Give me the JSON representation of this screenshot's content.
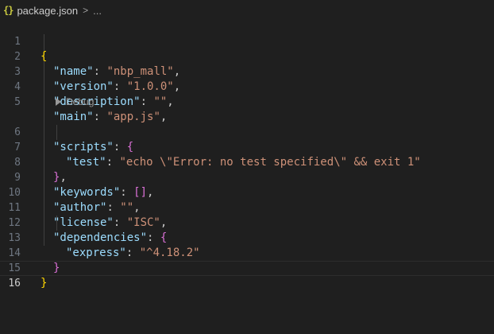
{
  "breadcrumb": {
    "icon": "json-braces-icon",
    "icon_glyph": "{}",
    "file": "package.json",
    "separator": ">",
    "more": "..."
  },
  "codelens": {
    "label": "Debug",
    "icon": "play-icon"
  },
  "current_line": 16,
  "colors": {
    "background": "#1f1f1f",
    "bracket_level1": "#ffd700",
    "bracket_level2": "#da70d6",
    "json_key": "#9cdcfe",
    "json_string": "#ce9178",
    "line_number": "#6e7681"
  },
  "lines": [
    {
      "n": "1",
      "a": "{",
      "b": "",
      "c": "",
      "d": "",
      "e": ""
    },
    {
      "n": "2",
      "a": "",
      "b": "\"name\"",
      "c": ": ",
      "d": "\"nbp_mall\"",
      "e": ","
    },
    {
      "n": "3",
      "a": "",
      "b": "\"version\"",
      "c": ": ",
      "d": "\"1.0.0\"",
      "e": ","
    },
    {
      "n": "4",
      "a": "",
      "b": "\"description\"",
      "c": ": ",
      "d": "\"\"",
      "e": ","
    },
    {
      "n": "5",
      "a": "",
      "b": "\"main\"",
      "c": ": ",
      "d": "\"app.js\"",
      "e": ","
    },
    {
      "n": "6",
      "a": "",
      "b": "\"scripts\"",
      "c": ": ",
      "d": "{",
      "e": ""
    },
    {
      "n": "7",
      "a": "",
      "b": "\"test\"",
      "c": ": ",
      "d": "\"echo \\\"Error: no test specified\\\" && exit 1\"",
      "e": ""
    },
    {
      "n": "8",
      "a": "",
      "b": "}",
      "c": ",",
      "d": "",
      "e": ""
    },
    {
      "n": "9",
      "a": "",
      "b": "\"keywords\"",
      "c": ": ",
      "d": "[]",
      "e": ","
    },
    {
      "n": "10",
      "a": "",
      "b": "\"author\"",
      "c": ": ",
      "d": "\"\"",
      "e": ","
    },
    {
      "n": "11",
      "a": "",
      "b": "\"license\"",
      "c": ": ",
      "d": "\"ISC\"",
      "e": ","
    },
    {
      "n": "12",
      "a": "",
      "b": "\"dependencies\"",
      "c": ": ",
      "d": "{",
      "e": ""
    },
    {
      "n": "13",
      "a": "",
      "b": "\"express\"",
      "c": ": ",
      "d": "\"^4.18.2\"",
      "e": ""
    },
    {
      "n": "14",
      "a": "",
      "b": "}",
      "c": "",
      "d": "",
      "e": ""
    },
    {
      "n": "15",
      "a": "}",
      "b": "",
      "c": "",
      "d": "",
      "e": ""
    },
    {
      "n": "16",
      "a": "",
      "b": "",
      "c": "",
      "d": "",
      "e": ""
    }
  ]
}
